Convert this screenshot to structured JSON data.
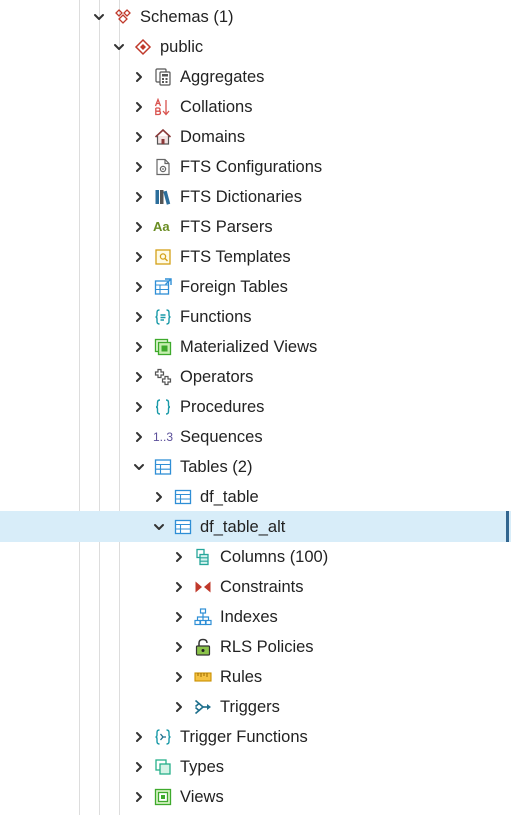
{
  "tree": {
    "schemas": {
      "label": "Schemas (1)"
    },
    "public": {
      "label": "public"
    },
    "items": [
      {
        "label": "Aggregates",
        "icon": "aggregates-icon"
      },
      {
        "label": "Collations",
        "icon": "collations-icon"
      },
      {
        "label": "Domains",
        "icon": "domains-icon"
      },
      {
        "label": "FTS Configurations",
        "icon": "fts-configurations-icon"
      },
      {
        "label": "FTS Dictionaries",
        "icon": "fts-dictionaries-icon"
      },
      {
        "label": "FTS Parsers",
        "icon": "fts-parsers-icon",
        "glyph": "Aa"
      },
      {
        "label": "FTS Templates",
        "icon": "fts-templates-icon"
      },
      {
        "label": "Foreign Tables",
        "icon": "foreign-tables-icon"
      },
      {
        "label": "Functions",
        "icon": "functions-icon"
      },
      {
        "label": "Materialized Views",
        "icon": "materialized-views-icon"
      },
      {
        "label": "Operators",
        "icon": "operators-icon"
      },
      {
        "label": "Procedures",
        "icon": "procedures-icon"
      },
      {
        "label": "Sequences",
        "icon": "sequences-icon",
        "glyph": "1..3"
      },
      {
        "label": "Tables (2)",
        "icon": "tables-icon"
      }
    ],
    "tables": [
      {
        "label": "df_table",
        "icon": "table-icon"
      },
      {
        "label": "df_table_alt",
        "icon": "table-icon",
        "selected": true
      }
    ],
    "table_children": [
      {
        "label": "Columns (100)",
        "icon": "columns-icon"
      },
      {
        "label": "Constraints",
        "icon": "constraints-icon"
      },
      {
        "label": "Indexes",
        "icon": "indexes-icon"
      },
      {
        "label": "RLS Policies",
        "icon": "rls-policies-icon"
      },
      {
        "label": "Rules",
        "icon": "rules-icon"
      },
      {
        "label": "Triggers",
        "icon": "triggers-icon"
      }
    ],
    "trailing": [
      {
        "label": "Trigger Functions",
        "icon": "trigger-functions-icon"
      },
      {
        "label": "Types",
        "icon": "types-icon"
      },
      {
        "label": "Views",
        "icon": "views-icon"
      }
    ]
  }
}
